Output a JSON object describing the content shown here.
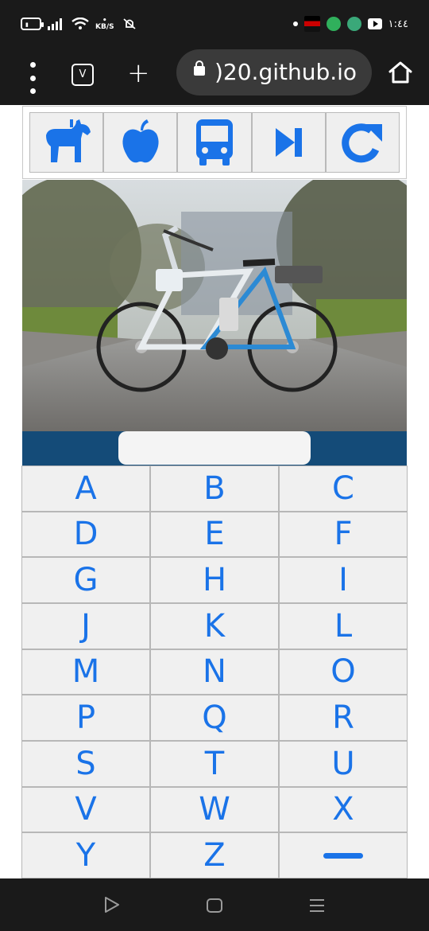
{
  "status_bar": {
    "speed_value": "•",
    "speed_unit": "KB/S",
    "time": "١:٤٤"
  },
  "browser": {
    "tab_count": "V",
    "new_tab": "+",
    "url": ")20.github.io"
  },
  "toolbar": {
    "buttons": [
      {
        "icon": "horse-icon"
      },
      {
        "icon": "apple-icon"
      },
      {
        "icon": "bus-icon"
      },
      {
        "icon": "skip-next-icon"
      },
      {
        "icon": "redo-icon"
      }
    ]
  },
  "answer": {
    "value": ""
  },
  "keyboard": {
    "keys": [
      "A",
      "B",
      "C",
      "D",
      "E",
      "F",
      "G",
      "H",
      "I",
      "J",
      "K",
      "L",
      "M",
      "N",
      "O",
      "P",
      "Q",
      "R",
      "S",
      "T",
      "U",
      "V",
      "W",
      "X",
      "Y",
      "Z"
    ],
    "last_key": "—"
  },
  "colors": {
    "accent": "#1a73e8",
    "answer_bar": "#144b78",
    "key_bg": "#f0f0f0"
  }
}
